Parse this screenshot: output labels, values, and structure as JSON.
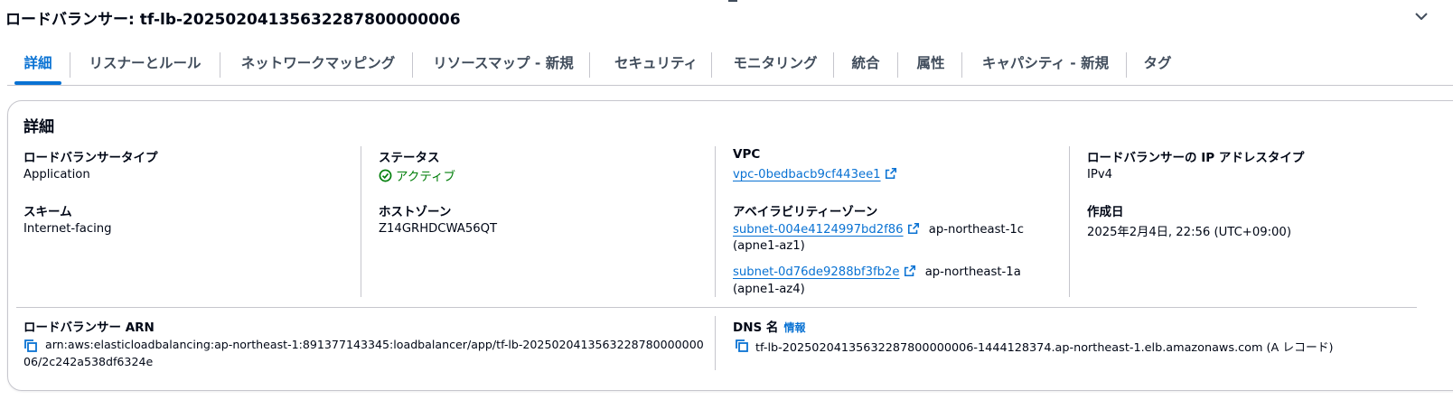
{
  "page": {
    "title": "ロードバランサー: tf-lb-20250204135632287800000006"
  },
  "tabs": [
    {
      "label": "詳細"
    },
    {
      "label": "リスナーとルール"
    },
    {
      "label": "ネットワークマッピング"
    },
    {
      "label": "リソースマップ - 新規"
    },
    {
      "label": "セキュリティ"
    },
    {
      "label": "モニタリング"
    },
    {
      "label": "統合"
    },
    {
      "label": "属性"
    },
    {
      "label": "キャパシティ - 新規"
    },
    {
      "label": "タグ"
    }
  ],
  "details": {
    "title": "詳細",
    "lb_type": {
      "label": "ロードバランサータイプ",
      "value": "Application"
    },
    "scheme": {
      "label": "スキーム",
      "value": "Internet-facing"
    },
    "status": {
      "label": "ステータス",
      "value": "アクティブ"
    },
    "hosted_zone": {
      "label": "ホストゾーン",
      "value": "Z14GRHDCWA56QT"
    },
    "vpc": {
      "label": "VPC",
      "value": "vpc-0bedbacb9cf443ee1"
    },
    "az": {
      "label": "アベイラビリティーゾーン",
      "items": [
        {
          "subnet": "subnet-004e4124997bd2f86",
          "zone": "ap-northeast-1c",
          "zone_id": "(apne1-az1)"
        },
        {
          "subnet": "subnet-0d76de9288bf3fb2e",
          "zone": "ap-northeast-1a",
          "zone_id": "(apne1-az4)"
        }
      ]
    },
    "ip_type": {
      "label": "ロードバランサーの IP アドレスタイプ",
      "value": "IPv4"
    },
    "created": {
      "label": "作成日",
      "value": "2025年2月4日, 22:56 (UTC+09:00)"
    },
    "arn": {
      "label": "ロードバランサー ARN",
      "line1": "arn:aws:elasticloadbalancing:ap-northeast-1:891377143345:loadbalancer/app/tf-lb-2025020413563228780000000",
      "line2": "06/2c242a538df6324e"
    },
    "dns": {
      "label": "DNS 名",
      "info": "情報",
      "value": "tf-lb-20250204135632287800000006-1444128374.ap-northeast-1.elb.amazonaws.com (A レコード)"
    }
  },
  "colors": {
    "accent": "#0972d3",
    "success": "#037f0c",
    "text": "#000716",
    "border": "#c6c6cd"
  }
}
